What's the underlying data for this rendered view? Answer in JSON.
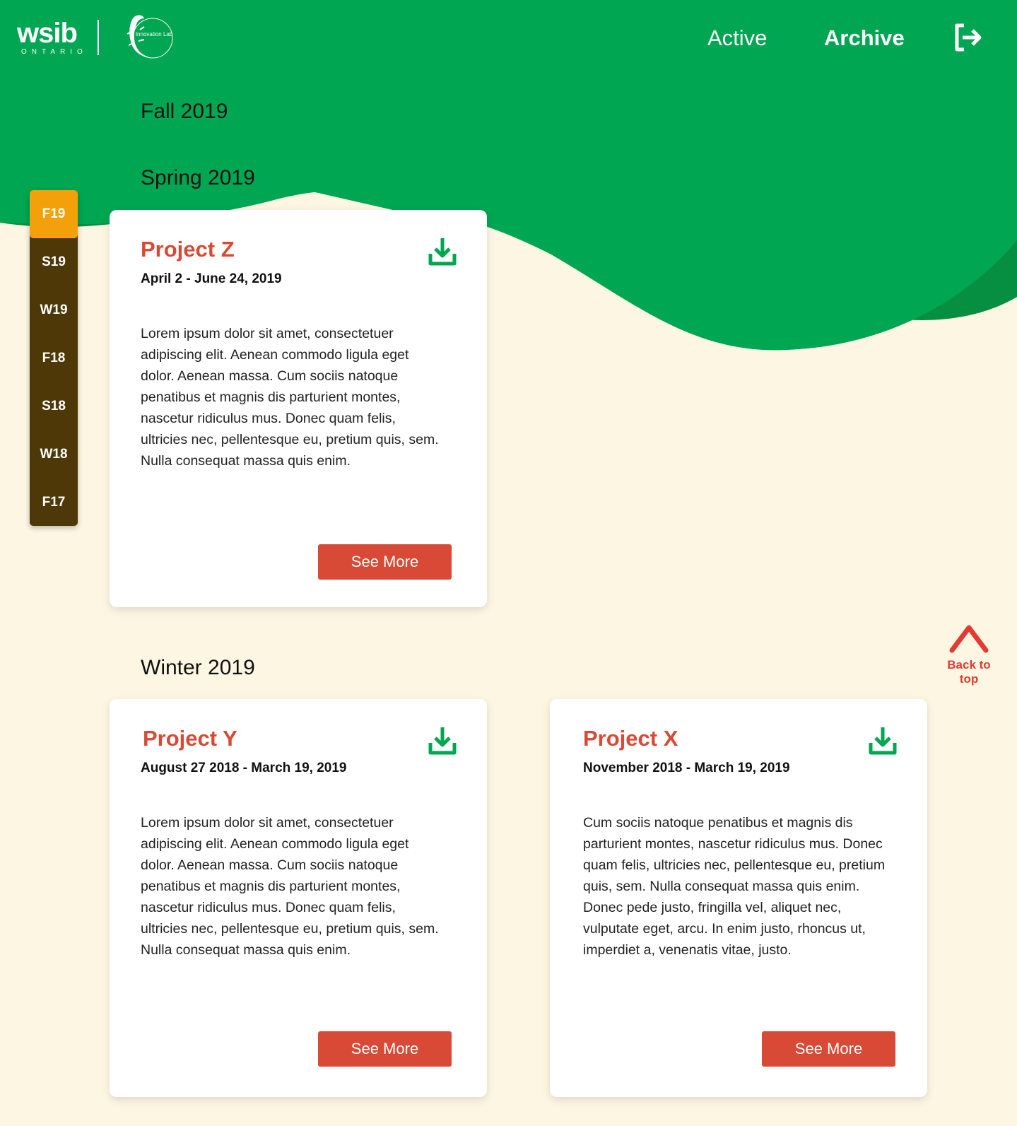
{
  "header": {
    "logo_main": "wsib",
    "logo_sub": "ONTARIO",
    "lab_name": "Innovation Lab",
    "nav": {
      "active_label": "Active",
      "archive_label": "Archive"
    }
  },
  "sections": {
    "fall_2019": "Fall 2019",
    "spring_2019": "Spring 2019",
    "winter_2019": "Winter 2019"
  },
  "sidebar": {
    "items": [
      {
        "label": "F19",
        "selected": true
      },
      {
        "label": "S19"
      },
      {
        "label": "W19"
      },
      {
        "label": "F18"
      },
      {
        "label": "S18"
      },
      {
        "label": "W18"
      },
      {
        "label": "F17"
      }
    ]
  },
  "cards": [
    {
      "title": "Project Z",
      "date": "April 2 - June 24, 2019",
      "body": "Lorem ipsum dolor sit amet, consectetuer adipiscing elit. Aenean commodo ligula eget dolor. Aenean massa. Cum sociis natoque penatibus et magnis dis parturient montes, nascetur ridiculus mus. Donec quam felis, ultricies nec, pellentesque eu, pretium quis, sem. Nulla consequat massa quis enim.",
      "button": "See More"
    },
    {
      "title": "Project Y",
      "date": "August 27 2018 - March 19, 2019",
      "body": "Lorem ipsum dolor sit amet, consectetuer adipiscing elit. Aenean commodo ligula eget dolor. Aenean massa. Cum sociis natoque penatibus et magnis dis parturient montes, nascetur ridiculus mus. Donec quam felis, ultricies nec, pellentesque eu, pretium quis, sem. Nulla consequat massa quis enim.",
      "button": "See More"
    },
    {
      "title": "Project X",
      "date": "November 2018 - March 19, 2019",
      "body": "Cum sociis natoque penatibus et magnis dis parturient montes, nascetur ridiculus mus. Donec quam felis, ultricies nec, pellentesque eu, pretium quis, sem. Nulla consequat massa quis enim. Donec pede justo, fringilla vel, aliquet nec, vulputate eget, arcu. In enim justo, rhoncus ut, imperdiet a, venenatis vitae, justo.",
      "button": "See More"
    }
  ],
  "back_to_top": {
    "label_line1": "Back to",
    "label_line2": "top"
  },
  "colors": {
    "green": "#00a651",
    "dark_green": "#068f41",
    "cream": "#fdf6e3",
    "accent_red": "#d84a35",
    "sidebar_brown": "#4f3807",
    "sidebar_selected": "#f2a10a"
  },
  "icons": {
    "download": "download-icon",
    "logout": "logout-icon",
    "back_to_top": "chevron-up-icon",
    "lab_logo": "lizard-icon"
  }
}
